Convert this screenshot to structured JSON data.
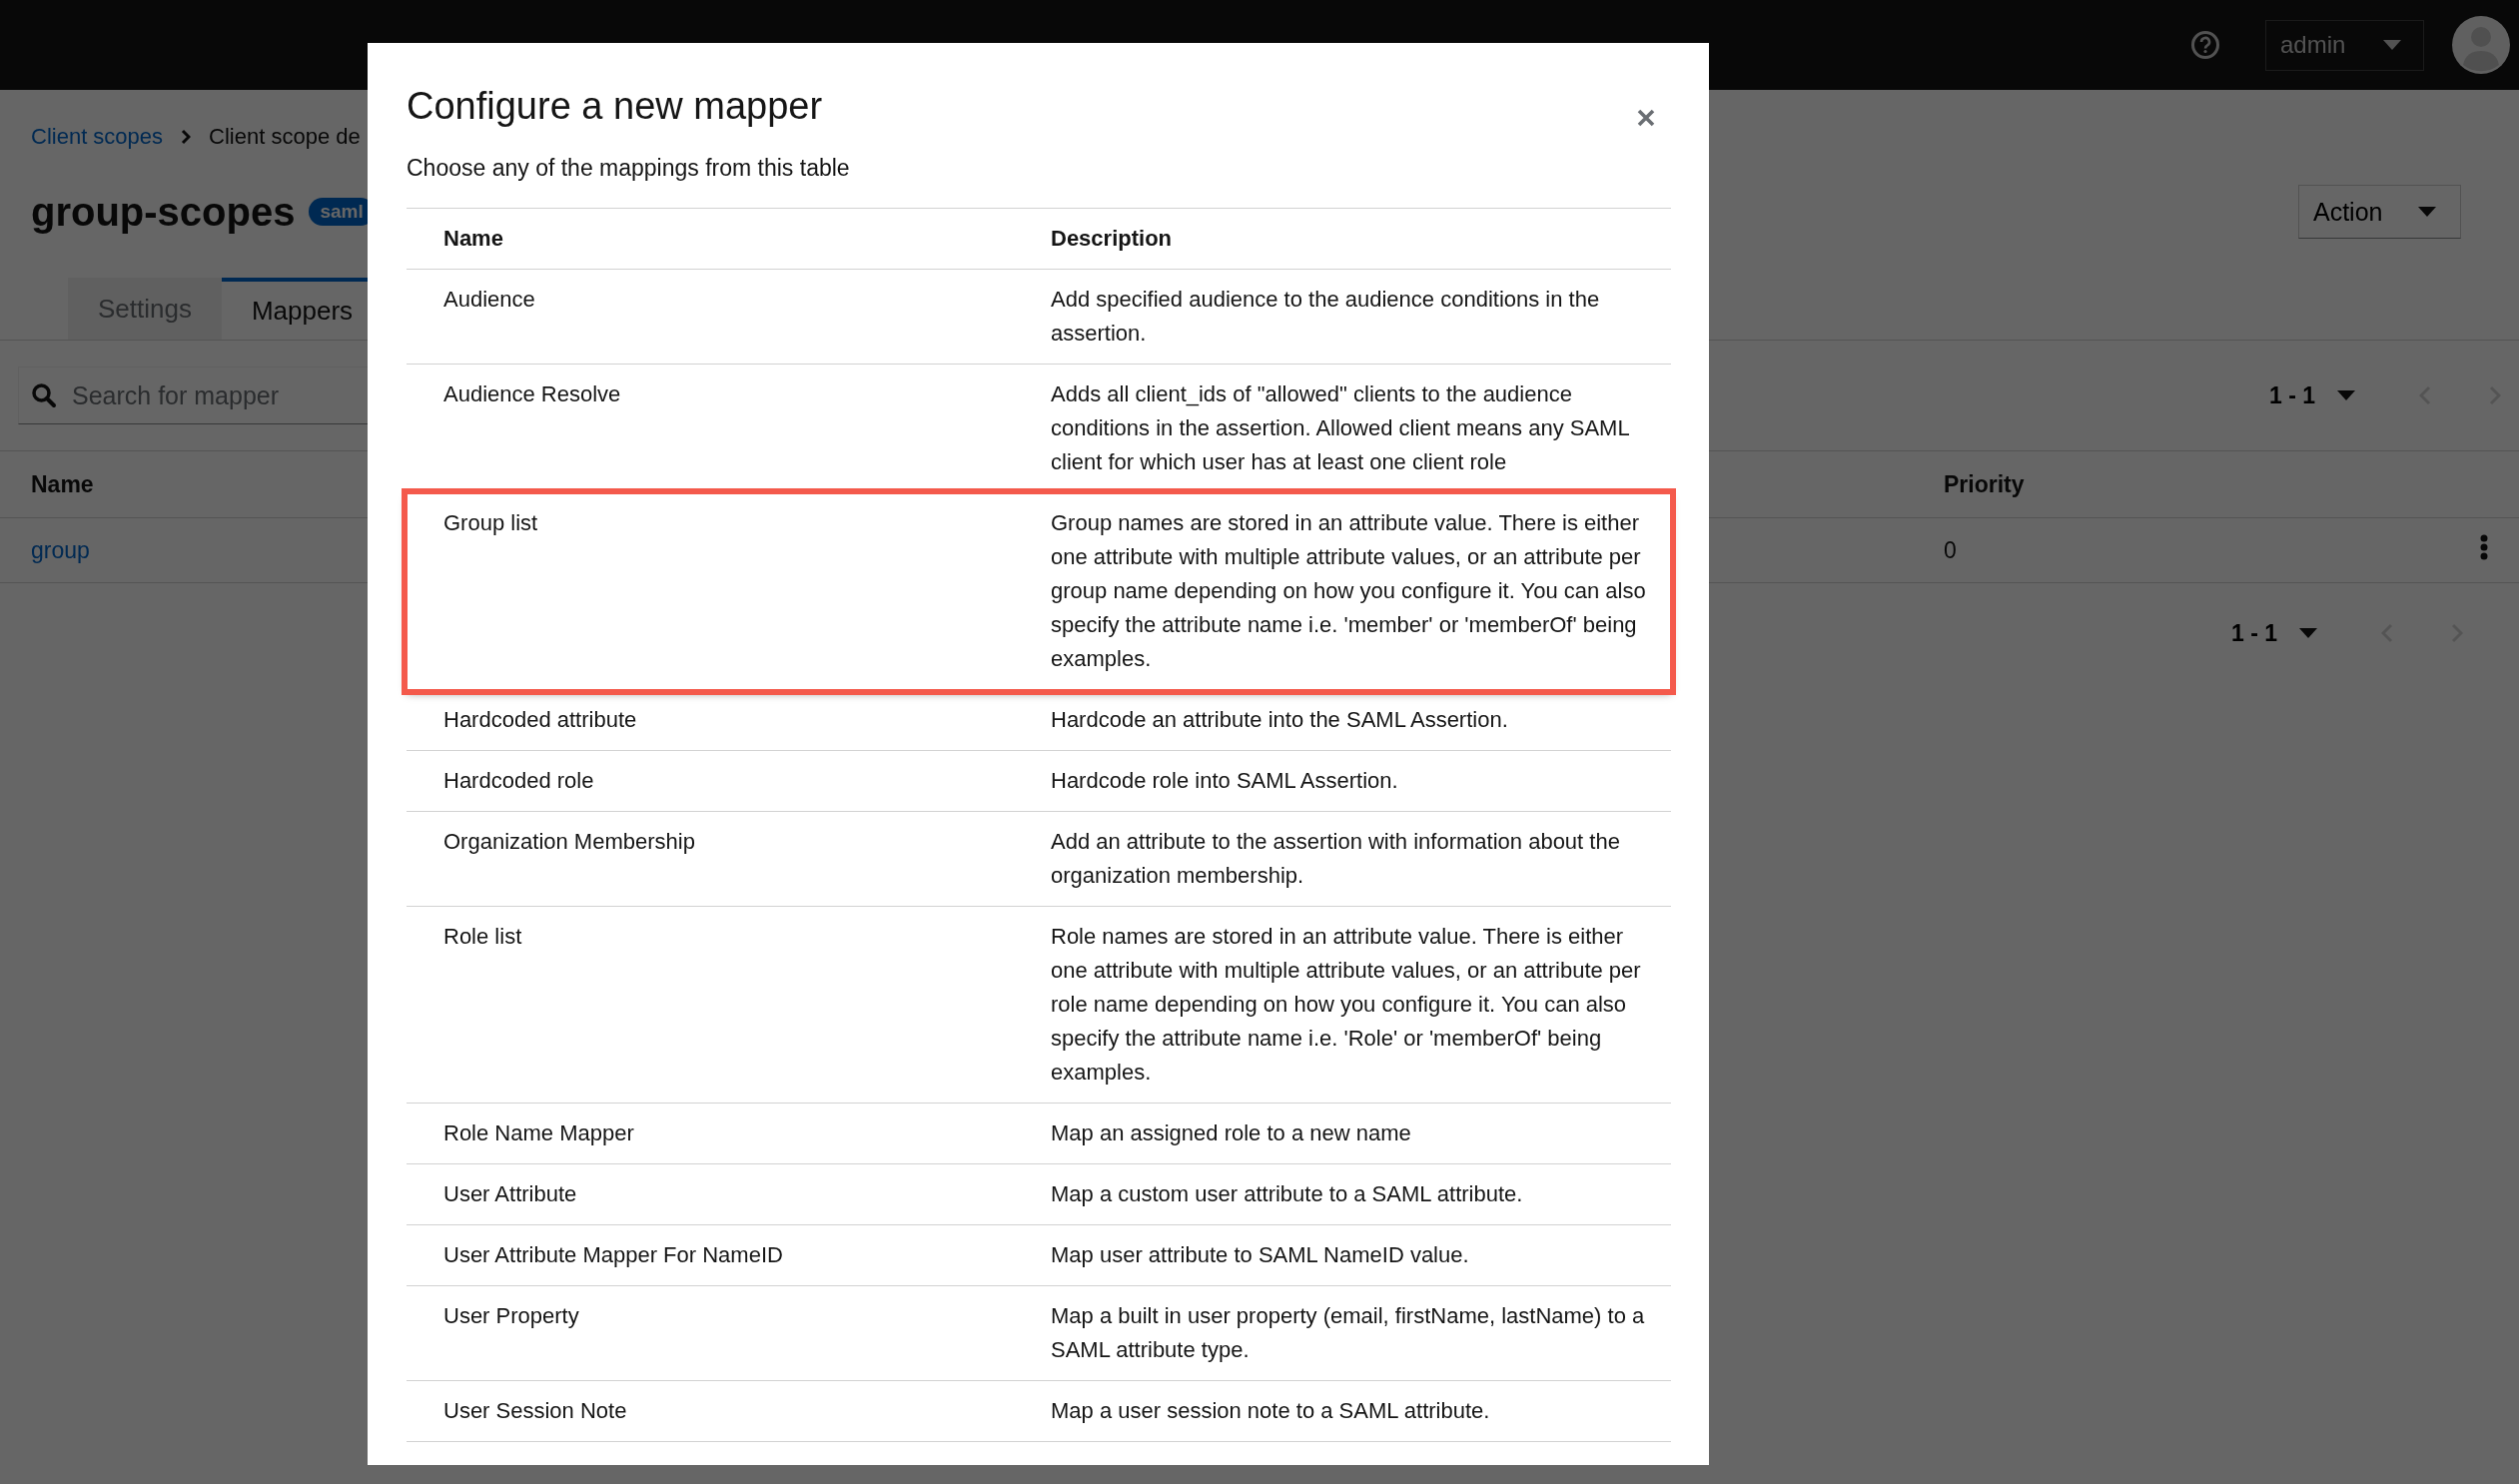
{
  "masthead": {
    "user_menu": "admin"
  },
  "page": {
    "breadcrumb": [
      "Client scopes",
      "Client scope de"
    ],
    "title": "group-scopes",
    "badge": "saml",
    "action": "Action",
    "tabs": [
      {
        "label": "Settings",
        "selected": false
      },
      {
        "label": "Mappers",
        "selected": true
      }
    ],
    "search": {
      "placeholder": "Search for mapper"
    },
    "pagination_top": "1 - 1",
    "table": {
      "columns": [
        "Name",
        "Priority"
      ],
      "rows": [
        {
          "name": "group",
          "priority": "0"
        }
      ]
    },
    "pagination_bottom": "1 - 1"
  },
  "modal": {
    "title": "Configure a new mapper",
    "subtitle": "Choose any of the mappings from this table",
    "columns": [
      "Name",
      "Description"
    ],
    "rows": [
      {
        "name": "Audience",
        "description": "Add specified audience to the audience conditions in the assertion.",
        "highlighted": false
      },
      {
        "name": "Audience Resolve",
        "description": "Adds all client_ids of \"allowed\" clients to the audience conditions in the assertion. Allowed client means any SAML client for which user has at least one client role",
        "highlighted": false
      },
      {
        "name": "Group list",
        "description": "Group names are stored in an attribute value. There is either one attribute with multiple attribute values, or an attribute per group name depending on how you configure it. You can also specify the attribute name i.e. 'member' or 'memberOf' being examples.",
        "highlighted": true
      },
      {
        "name": "Hardcoded attribute",
        "description": "Hardcode an attribute into the SAML Assertion.",
        "highlighted": false
      },
      {
        "name": "Hardcoded role",
        "description": "Hardcode role into SAML Assertion.",
        "highlighted": false
      },
      {
        "name": "Organization Membership",
        "description": "Add an attribute to the assertion with information about the organization membership.",
        "highlighted": false
      },
      {
        "name": "Role list",
        "description": "Role names are stored in an attribute value. There is either one attribute with multiple attribute values, or an attribute per role name depending on how you configure it. You can also specify the attribute name i.e. 'Role' or 'memberOf' being examples.",
        "highlighted": false
      },
      {
        "name": "Role Name Mapper",
        "description": "Map an assigned role to a new name",
        "highlighted": false
      },
      {
        "name": "User Attribute",
        "description": "Map a custom user attribute to a SAML attribute.",
        "highlighted": false
      },
      {
        "name": "User Attribute Mapper For NameID",
        "description": "Map user attribute to SAML NameID value.",
        "highlighted": false
      },
      {
        "name": "User Property",
        "description": "Map a built in user property (email, firstName, lastName) to a SAML attribute type.",
        "highlighted": false
      },
      {
        "name": "User Session Note",
        "description": "Map a user session note to a SAML attribute.",
        "highlighted": false
      }
    ]
  }
}
